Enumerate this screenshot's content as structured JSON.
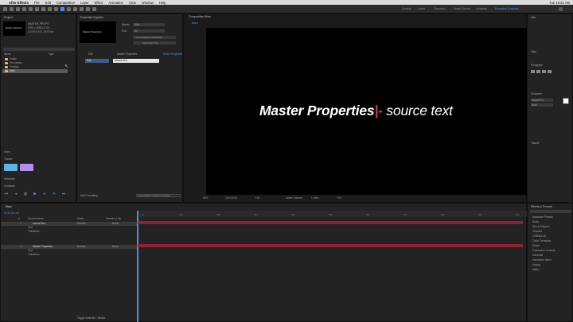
{
  "menubar": {
    "app": "After Effects",
    "items": [
      "File",
      "Edit",
      "Composition",
      "Layer",
      "Effect",
      "Animation",
      "View",
      "Window",
      "Help"
    ],
    "clock": "Tue 10:22 AM"
  },
  "toolbar": {
    "workspaces": [
      "Default",
      "Learn",
      "Standard",
      "Small Screen",
      "Libraries",
      "Essential Graphics"
    ],
    "active_workspace": "Essential Graphics"
  },
  "project_panel": {
    "tab": "Project",
    "preview_label": "Master Properties",
    "info_lines": [
      "MASTER_PROPS",
      "1920 x 1080 (1.00)",
      "Δ 0:00:10:00, 29.97 fps"
    ],
    "columns": [
      "Name",
      "Type"
    ],
    "items": [
      {
        "name": "Solids",
        "color": "#d4c27a"
      },
      {
        "name": "Pre-comps",
        "color": "#d4c27a"
      },
      {
        "name": "Footage",
        "color": "#d4c27a"
      },
      {
        "name": "Main",
        "color": "#d4c27a",
        "selected": true
      }
    ],
    "bpc": "8 bpc"
  },
  "essential_graphics": {
    "tab": "Essential Graphics",
    "preview_label": "Master Properties",
    "master_label": "Master",
    "master_value": "Main",
    "solo_label": "Solo",
    "solo_value": "All",
    "button_1": "Solo Supported Properties",
    "button_2": "Set Poster Time",
    "col_1": "Edit",
    "col_2": "Master Properties",
    "col_3": "Select Properties",
    "field_value": "source text",
    "add_formatting": "Add Formatting",
    "export_button": "Export Motion Graphics Template..."
  },
  "effects_panel": {
    "tab": "Tracker",
    "swatch_1": "#5bb6e6",
    "swatch_2": "#b58cf0",
    "section": "Animation",
    "section_2": "Character"
  },
  "composition": {
    "tab": "Composition Main",
    "subtab": "Main",
    "viewer_text_bold": "Master Properties",
    "viewer_text_cursor": "|-",
    "viewer_text_rest": " source text",
    "zoom": "50%",
    "timecode": "0;00;00;00",
    "quality": "Full",
    "camera": "Active Camera",
    "view": "1 View",
    "offset": "+0.0"
  },
  "character_panel": {
    "tab": "Info",
    "sections": [
      "Align",
      "Paragraph",
      "Character",
      "Tracker"
    ],
    "font": "Myriad Pro",
    "style": "Bold"
  },
  "effects_presets": {
    "tab": "Effects & Presets",
    "search_placeholder": "Search",
    "items": [
      "Animation Presets",
      "Audio",
      "Blur & Sharpen",
      "Channel",
      "CINEMA 4D",
      "Color Correction",
      "Distort",
      "Expression Controls",
      "Generate",
      "Immersive Video",
      "Keying",
      "Matte"
    ]
  },
  "timeline": {
    "tab": "Main",
    "timecode": "0;00;00;00",
    "columns": [
      "#",
      "Source Name",
      "Mode",
      "Parent & Link"
    ],
    "layers": [
      {
        "num": "1",
        "name": "source text",
        "mode": "Normal",
        "parent": "None"
      },
      {
        "num": "",
        "name": "Text",
        "mode": "",
        "parent": ""
      },
      {
        "num": "",
        "name": "Transform",
        "mode": "",
        "parent": ""
      },
      {
        "num": "2",
        "name": "Master Properties",
        "mode": "Normal",
        "parent": "None"
      },
      {
        "num": "",
        "name": "Text",
        "mode": "",
        "parent": ""
      },
      {
        "num": "",
        "name": "Transform",
        "mode": "",
        "parent": ""
      }
    ],
    "toggle_label": "Toggle Switches / Modes",
    "ruler": [
      "0s",
      "01s",
      "02s",
      "03s",
      "04s",
      "05s",
      "06s",
      "07s",
      "08s",
      "09s",
      "10s"
    ],
    "accent": "#8f2332"
  }
}
